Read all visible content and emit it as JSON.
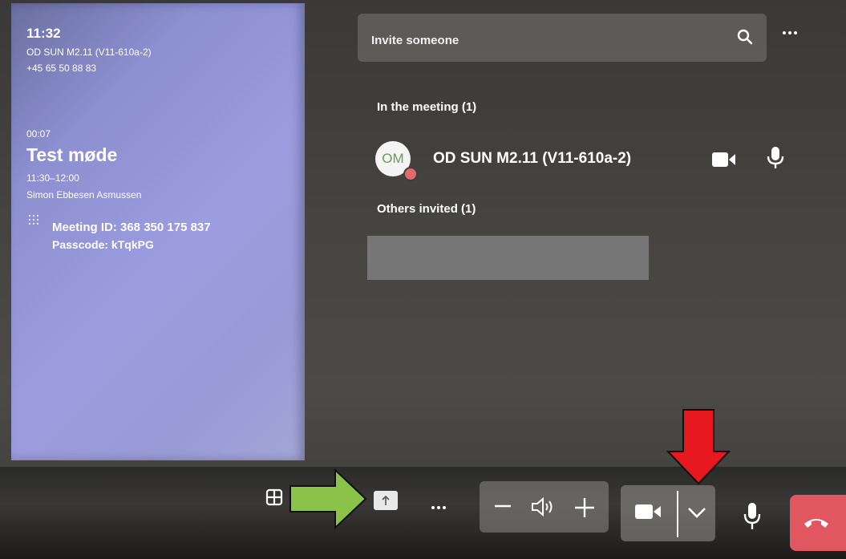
{
  "status": {
    "clock": "11:32",
    "device_name": "OD SUN M2.11 (V11-610a-2)",
    "device_phone": "+45 65 50 88 83"
  },
  "meeting": {
    "elapsed": "00:07",
    "title": "Test møde",
    "time_range": "11:30–12:00",
    "organizer": "Simon Ebbesen Asmussen",
    "meeting_id": "Meeting ID:  368 350 175 837",
    "passcode": "Passcode: kTqkPG"
  },
  "invite": {
    "placeholder": "Invite someone",
    "search_icon": "search-icon"
  },
  "participants": {
    "in_meeting_header": "In the meeting (1)",
    "list": [
      {
        "initials": "OM",
        "name": "OD SUN M2.11 (V11-610a-2)",
        "status_color": "#e06a6a"
      }
    ],
    "others_invited_header": "Others invited (1)"
  },
  "controls": {
    "layout_icon": "grid-layout-icon",
    "share_icon": "share-screen-icon",
    "more_icon": "more-horizontal-icon",
    "volume_down_icon": "minus-icon",
    "volume_icon": "speaker-icon",
    "volume_up_icon": "plus-icon",
    "video_icon": "video-camera-icon",
    "video_options_icon": "chevron-down-icon",
    "mic_icon": "microphone-icon",
    "hangup_icon": "hang-up-icon",
    "hangup_color": "#e0575f"
  },
  "annotations": {
    "green_arrow_color": "#8bc34a",
    "red_arrow_color": "#e8191e"
  }
}
